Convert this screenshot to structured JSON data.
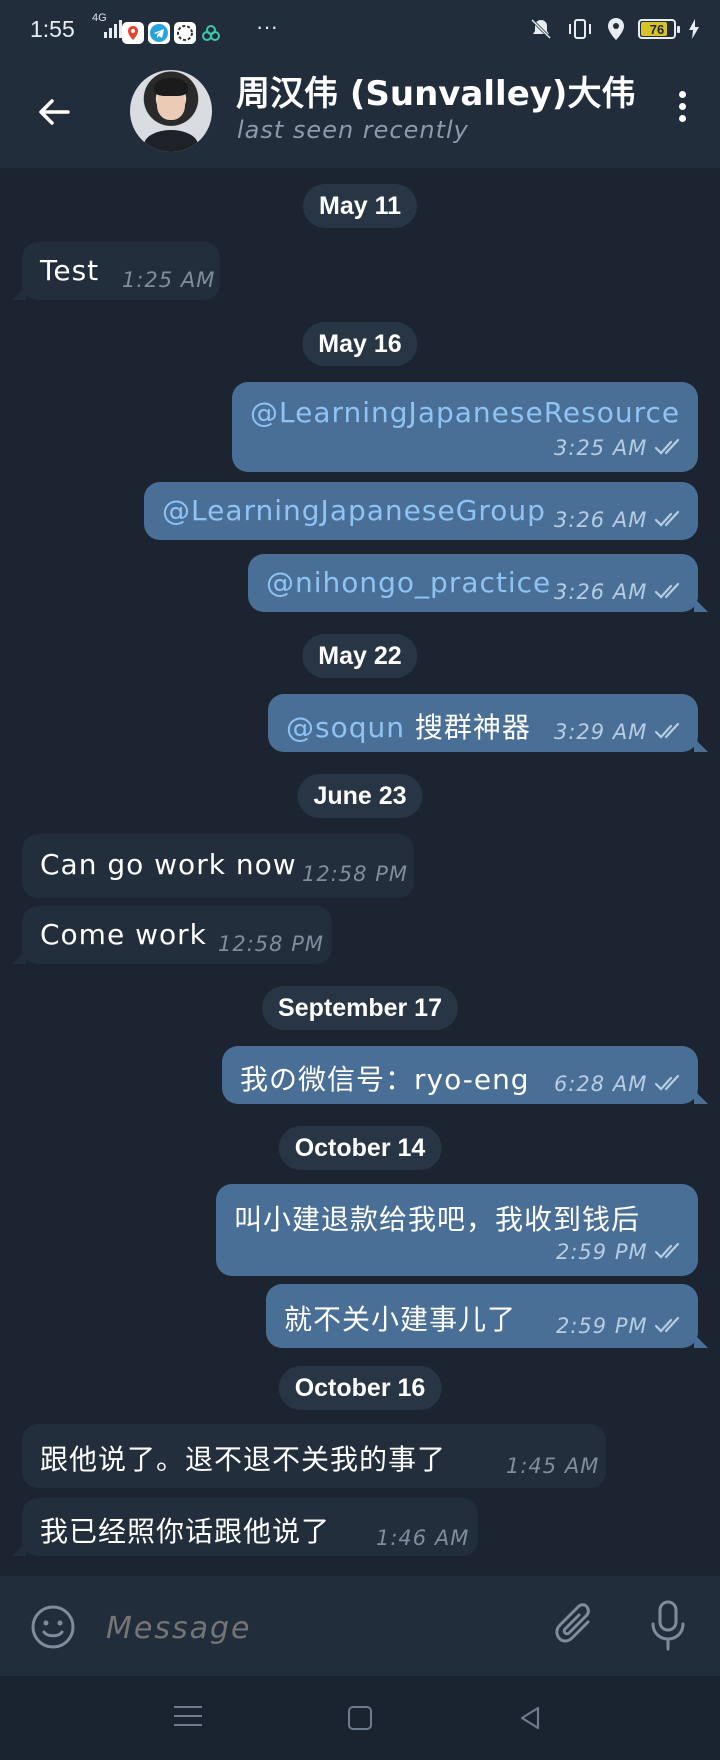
{
  "status_bar": {
    "time": "1:55",
    "network": "4G",
    "overflow": "···",
    "battery": "76",
    "icons": [
      "maps-icon",
      "telegram-icon",
      "signal-app-icon",
      "link-icon",
      "vibrate-mute-icon",
      "vibrate-icon",
      "location-icon",
      "battery-icon",
      "charging-icon"
    ]
  },
  "header": {
    "chat_name": "周汉伟 (Sunvalley)大伟",
    "status": "last seen recently"
  },
  "messages": [
    {
      "type": "date",
      "text": "May 11"
    },
    {
      "type": "in",
      "text": "Test",
      "time": "1:25 AM"
    },
    {
      "type": "date",
      "text": "May 16"
    },
    {
      "type": "out",
      "text": "@LearningJapaneseResource",
      "time": "3:25 AM",
      "read": true
    },
    {
      "type": "out",
      "text": "@LearningJapaneseGroup",
      "time": "3:26 AM",
      "read": true
    },
    {
      "type": "out",
      "text": "@nihongo_practice",
      "time": "3:26 AM",
      "read": true
    },
    {
      "type": "date",
      "text": "May 22"
    },
    {
      "type": "out",
      "mention": "@soqun",
      "text": " 搜群神器",
      "time": "3:29 AM",
      "read": true
    },
    {
      "type": "date",
      "text": "June 23"
    },
    {
      "type": "in",
      "text": "Can go work now",
      "time": "12:58 PM"
    },
    {
      "type": "in",
      "text": "Come work",
      "time": "12:58 PM"
    },
    {
      "type": "date",
      "text": "September 17"
    },
    {
      "type": "out",
      "text": "我の微信号：ryo-eng",
      "time": "6:28 AM",
      "read": true
    },
    {
      "type": "date",
      "text": "October 14"
    },
    {
      "type": "out",
      "text": "叫小建退款给我吧，我收到钱后",
      "time": "2:59 PM",
      "read": true
    },
    {
      "type": "out",
      "text": "就不关小建事儿了",
      "time": "2:59 PM",
      "read": true
    },
    {
      "type": "date",
      "text": "October 16"
    },
    {
      "type": "in",
      "text": "跟他说了。退不退不关我的事了",
      "time": "1:45 AM"
    },
    {
      "type": "in",
      "text": "我已经照你话跟他说了",
      "time": "1:46 AM"
    }
  ],
  "composer": {
    "placeholder": "Message"
  },
  "colors": {
    "background": "#1b2430",
    "header": "#212d3b",
    "incoming_bubble": "#222e3c",
    "outgoing_bubble": "#4a6f96",
    "mention": "#8ec3f4",
    "date_pill": "#283544"
  }
}
